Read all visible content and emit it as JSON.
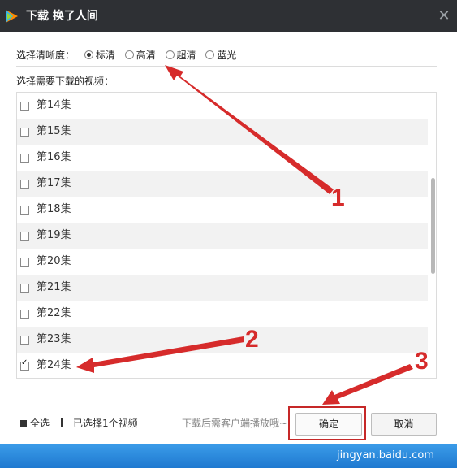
{
  "window": {
    "title": "下载  换了人间"
  },
  "quality": {
    "label": "选择清晰度：",
    "options": [
      {
        "label": "标清",
        "selected": true
      },
      {
        "label": "高清",
        "selected": false
      },
      {
        "label": "超清",
        "selected": false
      },
      {
        "label": "蓝光",
        "selected": false
      }
    ]
  },
  "videos": {
    "label": "选择需要下载的视频：",
    "items": [
      {
        "label": "第14集",
        "checked": false
      },
      {
        "label": "第15集",
        "checked": false
      },
      {
        "label": "第16集",
        "checked": false
      },
      {
        "label": "第17集",
        "checked": false
      },
      {
        "label": "第18集",
        "checked": false
      },
      {
        "label": "第19集",
        "checked": false
      },
      {
        "label": "第20集",
        "checked": false
      },
      {
        "label": "第21集",
        "checked": false
      },
      {
        "label": "第22集",
        "checked": false
      },
      {
        "label": "第23集",
        "checked": false
      },
      {
        "label": "第24集",
        "checked": true
      }
    ]
  },
  "footer": {
    "select_all": "全选",
    "selected_count": "已选择1个视频",
    "hint": "下载后需客户端播放哦~",
    "ok": "确定",
    "cancel": "取消"
  },
  "annotations": [
    "1",
    "2",
    "3"
  ],
  "watermark": "jingyan.baidu.com",
  "colors": {
    "titlebar": "#2e3034",
    "annotation": "#d62b2b",
    "bottom_strip": "#1f79d0"
  }
}
